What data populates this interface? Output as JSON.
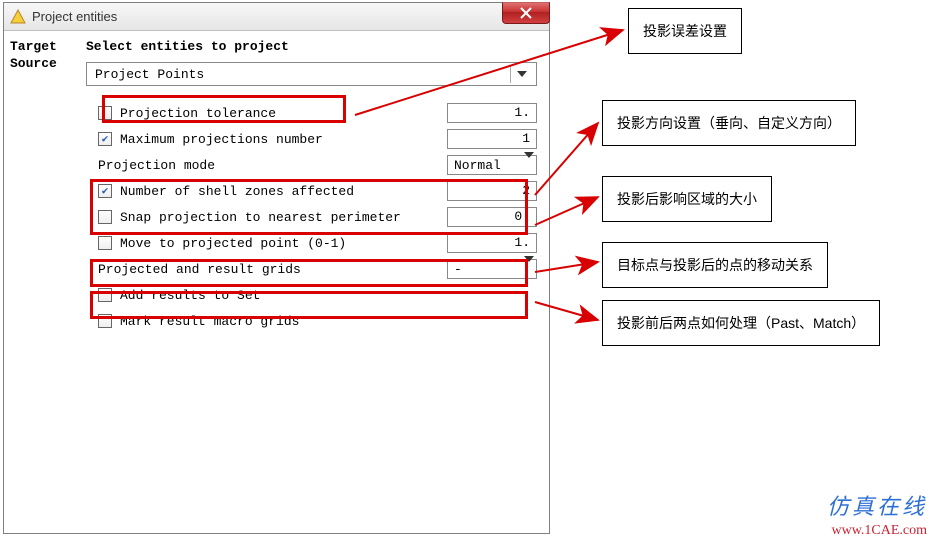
{
  "window": {
    "title": "Project entities"
  },
  "sidebar": {
    "items": [
      "Target",
      "Source"
    ]
  },
  "main": {
    "heading": "Select entities to project",
    "dropdown_label": "Project Points",
    "rows": {
      "proj_tol": {
        "label": "Projection tolerance",
        "value": "1."
      },
      "max_proj": {
        "label": "Maximum projections number",
        "value": "1"
      },
      "proj_mode": {
        "label": "Projection mode",
        "value": "Normal"
      },
      "shell_zones": {
        "label": "Number of shell zones affected",
        "value": "2"
      },
      "snap": {
        "label": "Snap projection to nearest perimeter",
        "value": "0."
      },
      "move_point": {
        "label": "Move to projected point (0-1)",
        "value": "1."
      },
      "proj_result": {
        "label": "Projected and result grids",
        "value": "-"
      },
      "add_results": {
        "label": "Add results to Set"
      },
      "mark_macro": {
        "label": "Mark result macro grids"
      }
    }
  },
  "annotations": {
    "a1": "投影误差设置",
    "a2": "投影方向设置（垂向、自定义方向）",
    "a3": "投影后影响区域的大小",
    "a4": "目标点与投影后的点的移动关系",
    "a5": "投影前后两点如何处理（Past、Match）"
  },
  "watermark": {
    "line1": "",
    "line2": ""
  },
  "footer": {
    "cn": "仿真在线",
    "url": "www.1CAE.com"
  }
}
